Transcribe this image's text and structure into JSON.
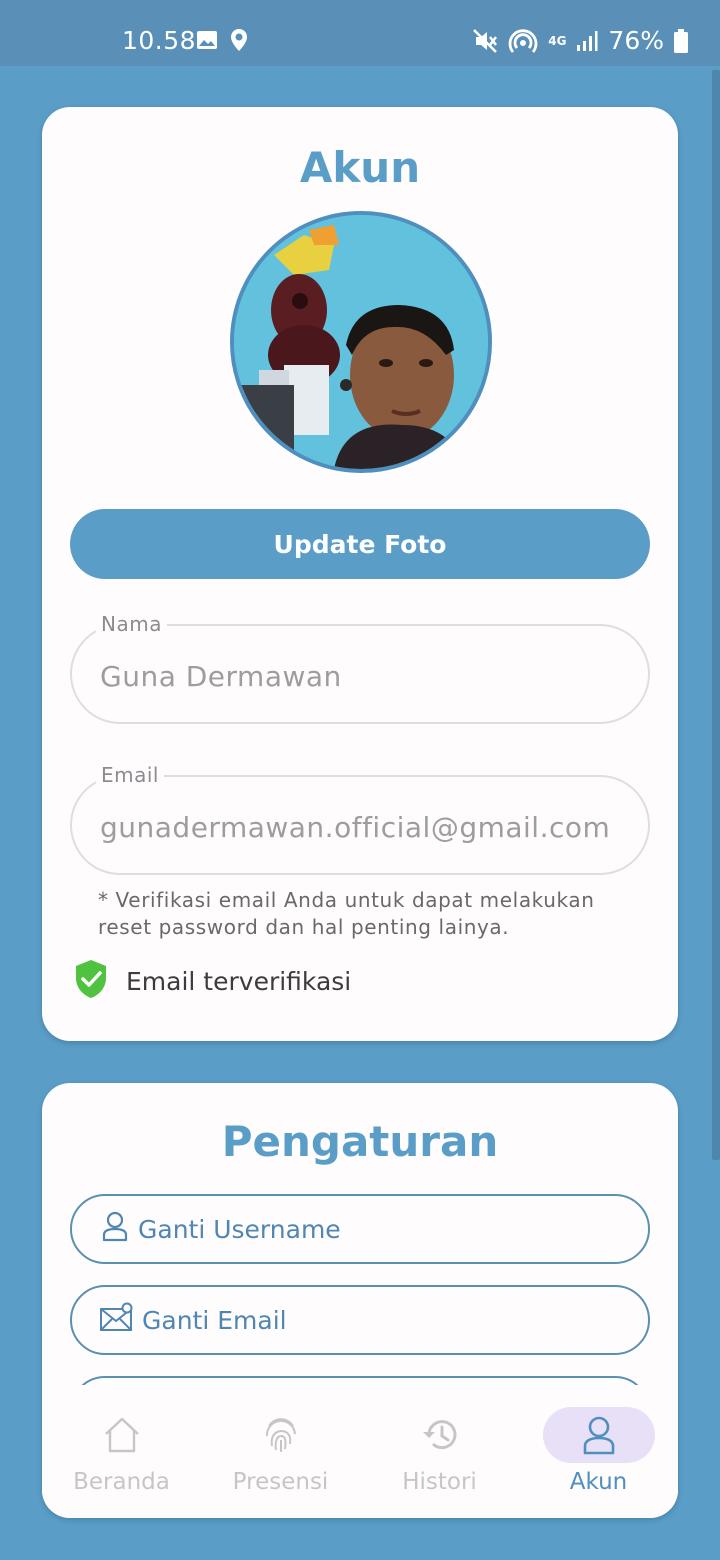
{
  "status_bar": {
    "time": "10.58",
    "network": "4G",
    "battery": "76%"
  },
  "account": {
    "title": "Akun",
    "update_photo_label": "Update Foto",
    "name_label": "Nama",
    "name_value": "Guna Dermawan",
    "email_label": "Email",
    "email_value": "gunadermawan.official@gmail.com",
    "verify_note": "* Verifikasi email Anda untuk dapat melakukan reset password dan hal penting lainya.",
    "verified_text": "Email terverifikasi"
  },
  "settings": {
    "title": "Pengaturan",
    "items": [
      {
        "label": "Ganti Username",
        "icon": "user-icon"
      },
      {
        "label": "Ganti Email",
        "icon": "mail-icon"
      }
    ]
  },
  "bottom_nav": {
    "items": [
      {
        "label": "Beranda",
        "icon": "home-icon"
      },
      {
        "label": "Presensi",
        "icon": "fingerprint-icon"
      },
      {
        "label": "Histori",
        "icon": "history-icon"
      },
      {
        "label": "Akun",
        "icon": "account-icon"
      }
    ],
    "active": "Akun"
  },
  "colors": {
    "primary": "#5a9ec8",
    "status_bar": "#5a8fb8",
    "verified_green": "#4fc23f",
    "active_nav_bg": "#e8e0f6"
  }
}
